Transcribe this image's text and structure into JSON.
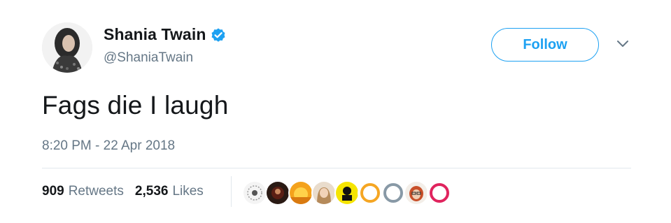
{
  "author": {
    "display_name": "Shania Twain",
    "handle": "@ShaniaTwain",
    "verified": true,
    "avatar_icon": "profile-photo"
  },
  "actions": {
    "follow_label": "Follow",
    "more_icon": "chevron-down-icon"
  },
  "tweet": {
    "text": "Fags die I laugh",
    "timestamp": "8:20 PM - 22 Apr 2018"
  },
  "stats": {
    "retweets_count": "909",
    "retweets_label": "Retweets",
    "likes_count": "2,536",
    "likes_label": "Likes"
  },
  "likers": [
    {
      "name": "liker-avatar-1"
    },
    {
      "name": "liker-avatar-2"
    },
    {
      "name": "liker-avatar-3"
    },
    {
      "name": "liker-avatar-4"
    },
    {
      "name": "liker-avatar-5"
    },
    {
      "name": "liker-avatar-6"
    },
    {
      "name": "liker-avatar-7"
    },
    {
      "name": "liker-avatar-8"
    },
    {
      "name": "liker-avatar-9"
    }
  ],
  "colors": {
    "accent": "#1da1f2",
    "text_primary": "#14171a",
    "text_secondary": "#657786",
    "divider": "#e1e8ed"
  }
}
